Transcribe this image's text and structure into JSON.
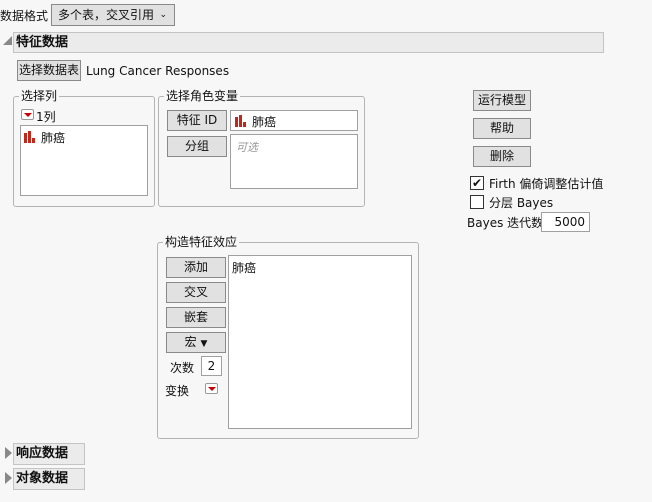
{
  "format": {
    "label": "数据格式",
    "value": "多个表，交叉引用"
  },
  "feature_section": {
    "title": "特征数据",
    "select_table_button": "选择数据表",
    "table_name": "Lung Cancer Responses"
  },
  "select_columns": {
    "title": "选择列",
    "count": "1列",
    "items": [
      "肺癌"
    ]
  },
  "roles": {
    "title": "选择角色变量",
    "feature_id_button": "特征 ID",
    "feature_id_value": "肺癌",
    "group_button": "分组",
    "group_placeholder": "可选"
  },
  "actions": {
    "run": "运行模型",
    "help": "帮助",
    "remove": "删除"
  },
  "options": {
    "firth_label": "Firth 偏倚调整估计值",
    "firth_checked": true,
    "hier_bayes_label": "分层 Bayes",
    "hier_bayes_checked": false,
    "bayes_iter_label": "Bayes 迭代数",
    "bayes_iter_value": "5000"
  },
  "effects": {
    "title": "构造特征效应",
    "add": "添加",
    "cross": "交叉",
    "nest": "嵌套",
    "macro": "宏",
    "degree_label": "次数",
    "degree_value": "2",
    "transform_label": "变换",
    "items": [
      "肺癌"
    ]
  },
  "response_section": {
    "title": "响应数据"
  },
  "subject_section": {
    "title": "对象数据"
  },
  "colors": {
    "accent_red": "#c0281c"
  }
}
